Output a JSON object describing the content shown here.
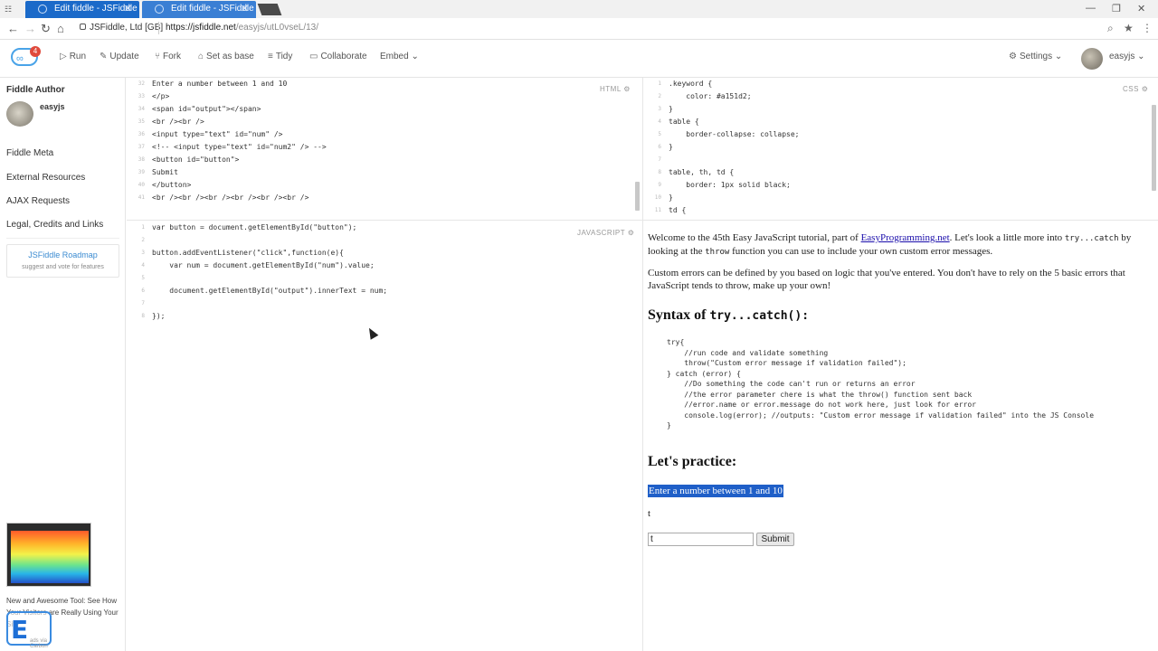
{
  "browser": {
    "tabs": [
      {
        "title": "Edit fiddle - JSFiddle",
        "active": true
      },
      {
        "title": "Edit fiddle - JSFiddle",
        "active": false
      }
    ],
    "site_identity": "JSFiddle, Ltd [GB]",
    "url_prefix": "https://jsfiddle.net",
    "url_path": "/easyjs/utL0vseL/13/",
    "colors": {
      "tab_active": "#1b6ac9",
      "tab_inactive": "#3a7fd4"
    }
  },
  "toolbar": {
    "badge_count": "4",
    "run": "Run",
    "update": "Update",
    "fork": "Fork",
    "set_as_base": "Set as base",
    "tidy": "Tidy",
    "collaborate": "Collaborate",
    "embed": "Embed",
    "settings": "Settings",
    "username": "easyjs"
  },
  "sidebar": {
    "author_heading": "Fiddle Author",
    "author_name": "easyjs",
    "meta": "Fiddle Meta",
    "external_resources": "External Resources",
    "ajax_requests": "AJAX Requests",
    "legal": "Legal, Credits and Links",
    "roadmap_title": "JSFiddle Roadmap",
    "roadmap_sub": "suggest and vote for features",
    "ad_text": "New and Awesome Tool: See How Your Visitors are Really Using Your Site",
    "carbon_label": "ads via Carbon"
  },
  "html_panel": {
    "label": "HTML",
    "line_numbers": [
      "32",
      "33",
      "34",
      "35",
      "36",
      "37",
      "38",
      "39",
      "40",
      "41"
    ],
    "lines": [
      "Enter a number between 1 and 10",
      "</p>",
      "<span id=\"output\"></span>",
      "<br /><br />",
      "<input type=\"text\" id=\"num\" />",
      "<!-- <input type=\"text\" id=\"num2\" /> -->",
      "<button id=\"button\">",
      "Submit",
      "</button>",
      "<br /><br /><br /><br /><br /><br />"
    ]
  },
  "css_panel": {
    "label": "CSS",
    "line_numbers": [
      "1",
      "2",
      "3",
      "4",
      "5",
      "6",
      "7",
      "8",
      "9",
      "10",
      "11"
    ],
    "lines": [
      ".keyword {",
      "    color: #a151d2;",
      "}",
      "table {",
      "    border-collapse: collapse;",
      "}",
      "",
      "table, th, td {",
      "    border: 1px solid black;",
      "}",
      "td {"
    ]
  },
  "js_panel": {
    "label": "JAVASCRIPT",
    "line_numbers": [
      "1",
      "2",
      "3",
      "4",
      "5",
      "6",
      "7",
      "8"
    ],
    "lines": [
      "var button = document.getElementById(\"button\");",
      "",
      "button.addEventListener(\"click\",function(e){",
      "    var num = document.getElementById(\"num\").value;",
      "",
      "    document.getElementById(\"output\").innerText = num;",
      "",
      "});"
    ]
  },
  "result": {
    "intro_1a": "Welcome to the 45th Easy JavaScript tutorial, part of ",
    "intro_link": "EasyProgramming.net",
    "intro_1b": ". Let's look a little more into ",
    "intro_code1": "try...catch",
    "intro_1c": " by looking at the ",
    "intro_code2": "throw",
    "intro_1d": " function you can use to include your own custom error messages.",
    "intro_2": "Custom errors can be defined by you based on logic that you've entered. You don't have to rely on the 5 basic errors that JavaScript tends to throw, make up your own!",
    "syntax_heading_a": "Syntax of ",
    "syntax_heading_code": "try...catch():",
    "code_lines": [
      "try{",
      "    //run code and validate something",
      "    throw(\"Custom error message if validation failed\");",
      "} catch (error) {",
      "    //Do something the code can't run or returns an error",
      "    //the error parameter chere is what the throw() function sent back",
      "    //error.name or error.message do not work here, just look for error",
      "    console.log(error); //outputs: \"Custom error message if validation failed\" into the JS Console",
      "}"
    ],
    "practice_heading": "Let's practice:",
    "prompt": "Enter a number between 1 and 10",
    "output_value": "t",
    "input_value": "t",
    "submit": "Submit"
  }
}
